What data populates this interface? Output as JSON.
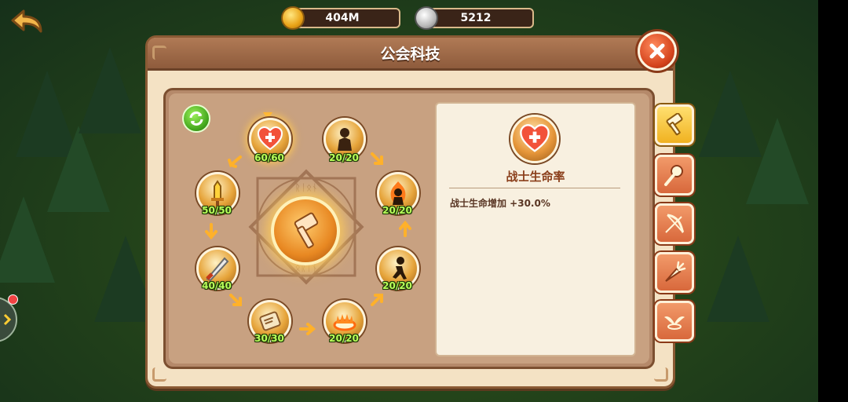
{
  "top_bar": {
    "gold": "404M",
    "stone": "5212"
  },
  "panel": {
    "title": "公会科技"
  },
  "skills": [
    {
      "id": "heart",
      "progress": "60/60",
      "icon": "heart-cross-icon"
    },
    {
      "id": "warrior",
      "progress": "20/20",
      "icon": "warrior-silhouette-icon"
    },
    {
      "id": "flame-warrior",
      "progress": "20/20",
      "icon": "flame-warrior-icon"
    },
    {
      "id": "runner",
      "progress": "20/20",
      "icon": "runner-icon"
    },
    {
      "id": "fire-ring",
      "progress": "20/20",
      "icon": "fire-ring-icon"
    },
    {
      "id": "scroll",
      "progress": "30/30",
      "icon": "scroll-icon"
    },
    {
      "id": "blade",
      "progress": "40/40",
      "icon": "blade-icon"
    },
    {
      "id": "sword",
      "progress": "50/50",
      "icon": "sword-icon"
    }
  ],
  "detail": {
    "title": "战士生命率",
    "effect": "战士生命增加  +30.0%"
  },
  "tabs": [
    {
      "icon": "hammer-icon",
      "active": true
    },
    {
      "icon": "staff-icon",
      "active": false
    },
    {
      "icon": "bow-icon",
      "active": false
    },
    {
      "icon": "carrot-icon",
      "active": false
    },
    {
      "icon": "wings-icon",
      "active": false
    }
  ],
  "colors": {
    "progress_text": "#b9ff5a",
    "title_bar": "#8e5b3c",
    "close_button": "#d4431c",
    "active_tab": "#f0b220"
  }
}
